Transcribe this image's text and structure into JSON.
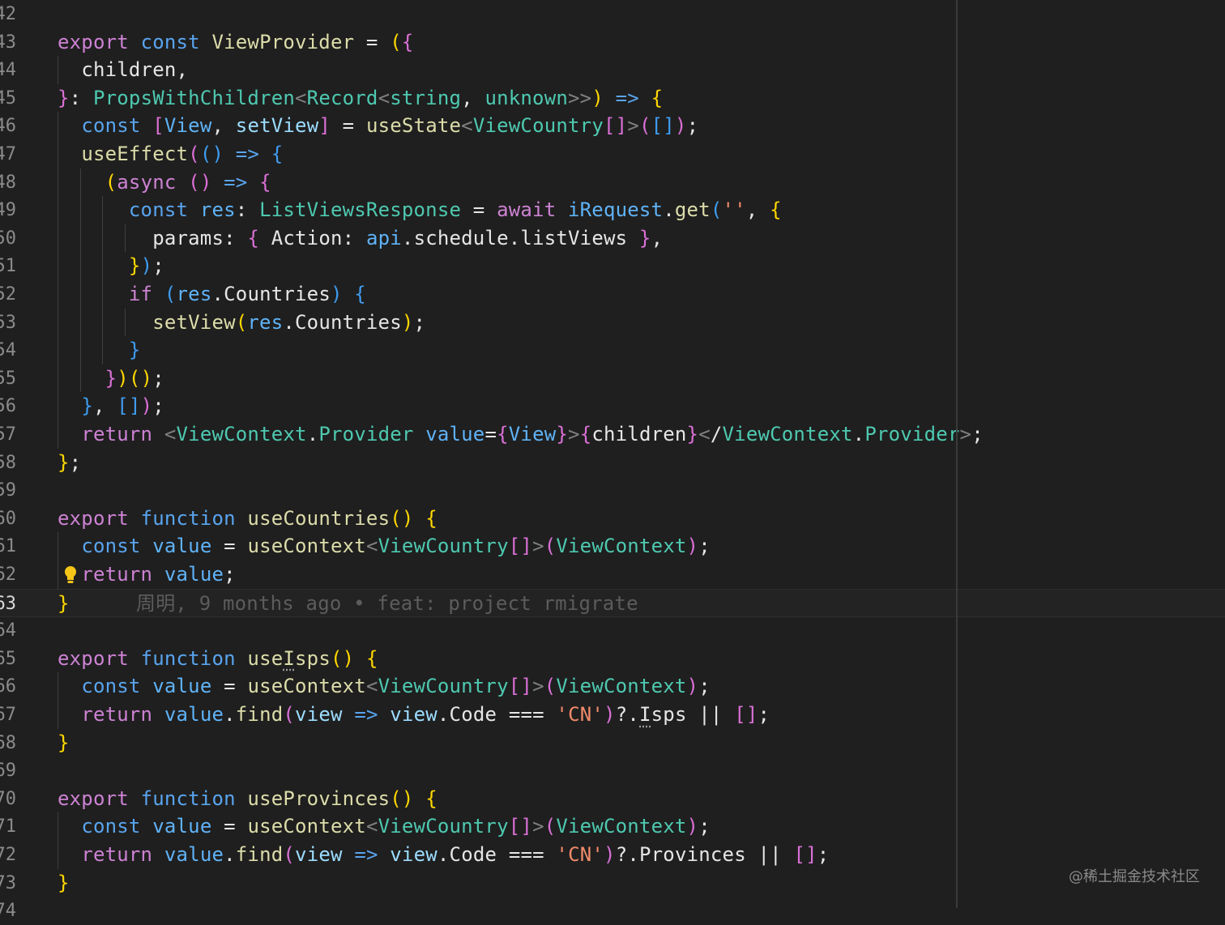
{
  "editor": {
    "current_line": "63",
    "lines": [
      {
        "n": "42",
        "text": ""
      },
      {
        "n": "43",
        "text": "export const ViewProvider = ({"
      },
      {
        "n": "44",
        "text": "  children,"
      },
      {
        "n": "45",
        "text": "}: PropsWithChildren<Record<string, unknown>>) => {"
      },
      {
        "n": "46",
        "text": "  const [View, setView] = useState<ViewCountry[]>([]);"
      },
      {
        "n": "47",
        "text": "  useEffect(() => {"
      },
      {
        "n": "48",
        "text": "    (async () => {"
      },
      {
        "n": "49",
        "text": "      const res: ListViewsResponse = await iRequest.get('', {"
      },
      {
        "n": "50",
        "text": "        params: { Action: api.schedule.listViews },"
      },
      {
        "n": "51",
        "text": "      });"
      },
      {
        "n": "52",
        "text": "      if (res.Countries) {"
      },
      {
        "n": "53",
        "text": "        setView(res.Countries);"
      },
      {
        "n": "54",
        "text": "      }"
      },
      {
        "n": "55",
        "text": "    })();"
      },
      {
        "n": "56",
        "text": "  }, []);"
      },
      {
        "n": "57",
        "text": "  return <ViewContext.Provider value={View}>{children}</ViewContext.Provider>;"
      },
      {
        "n": "58",
        "text": "};"
      },
      {
        "n": "59",
        "text": ""
      },
      {
        "n": "60",
        "text": "export function useCountries() {"
      },
      {
        "n": "61",
        "text": "  const value = useContext<ViewCountry[]>(ViewContext);"
      },
      {
        "n": "62",
        "text": "  return value;"
      },
      {
        "n": "63",
        "text": "}"
      },
      {
        "n": "64",
        "text": ""
      },
      {
        "n": "65",
        "text": "export function useIsps() {"
      },
      {
        "n": "66",
        "text": "  const value = useContext<ViewCountry[]>(ViewContext);"
      },
      {
        "n": "67",
        "text": "  return value.find(view => view.Code === 'CN')?.Isps || [];"
      },
      {
        "n": "68",
        "text": "}"
      },
      {
        "n": "69",
        "text": ""
      },
      {
        "n": "70",
        "text": "export function useProvinces() {"
      },
      {
        "n": "71",
        "text": "  const value = useContext<ViewCountry[]>(ViewContext);"
      },
      {
        "n": "72",
        "text": "  return value.find(view => view.Code === 'CN')?.Provinces || [];"
      },
      {
        "n": "73",
        "text": "}"
      },
      {
        "n": "74",
        "text": ""
      }
    ],
    "blame_annotation": "周明, 9 months ago • feat: project rmigrate",
    "lightbulb_icon": "lightbulb-icon"
  },
  "watermark": "@稀土掘金技术社区",
  "colors": {
    "background": "#1f1f1f",
    "keyword": "#cd82d3",
    "storage": "#59a4ee",
    "function": "#dcdcaa",
    "type": "#4ec9b0",
    "variable": "#9cdcfe",
    "string": "#f28b6b",
    "bracket_gold": "#ffd700",
    "bracket_orchid": "#da70d6",
    "bracket_blue": "#3f9cf0"
  }
}
